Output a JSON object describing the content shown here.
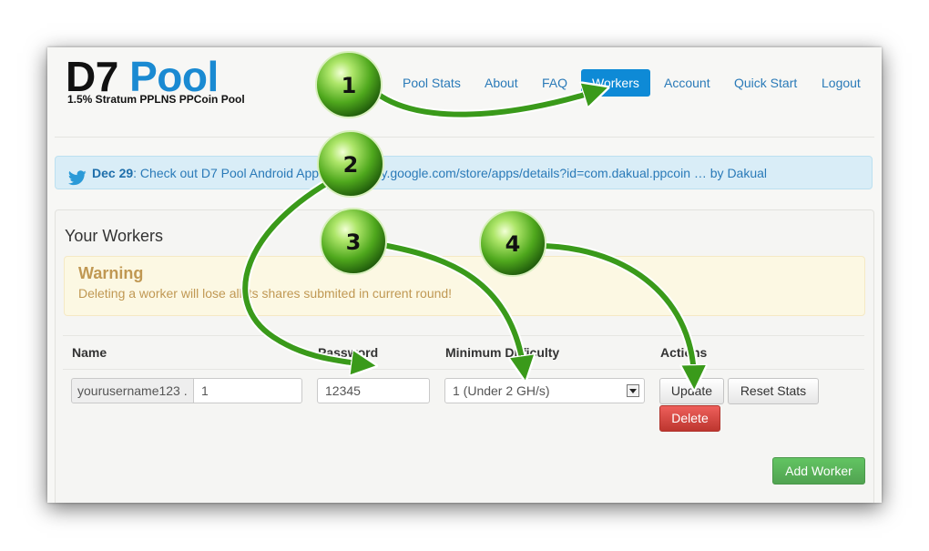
{
  "brand": {
    "title_part1": "D7",
    "title_part2": "Pool",
    "subtitle": "1.5% Stratum PPLNS PPCoin Pool"
  },
  "nav": {
    "items": [
      "Pool Stats",
      "About",
      "FAQ",
      "Workers",
      "Account",
      "Quick Start",
      "Logout"
    ],
    "active": "Workers"
  },
  "news": {
    "date": "Dec 29",
    "text": ": Check out D7 Pool Android App: https://play.google.com/store/apps/details?id=com.dakual.ppcoin … by Dakual",
    "icon": "twitter-bird-icon"
  },
  "workers": {
    "title": "Your Workers",
    "warning_title": "Warning",
    "warning_text": "Deleting a worker will lose all its shares submited in current round!",
    "columns": [
      "Name",
      "Password",
      "Minimum Difficulty",
      "Actions"
    ],
    "row": {
      "username_prefix": "yourusername123 .",
      "worker_suffix": "1",
      "password": "12345",
      "difficulty": "1 (Under 2 GH/s)"
    },
    "buttons": {
      "update": "Update",
      "reset": "Reset Stats",
      "delete": "Delete",
      "add": "Add Worker"
    }
  },
  "callouts": [
    "1",
    "2",
    "3",
    "4"
  ],
  "colors": {
    "accent": "#0e8ad6",
    "brand_blue": "#1a8ad2",
    "warning_text": "#c09853",
    "delete_red": "#d9534f",
    "add_green": "#5cb85c",
    "arrow_green": "#3a9a1a"
  }
}
